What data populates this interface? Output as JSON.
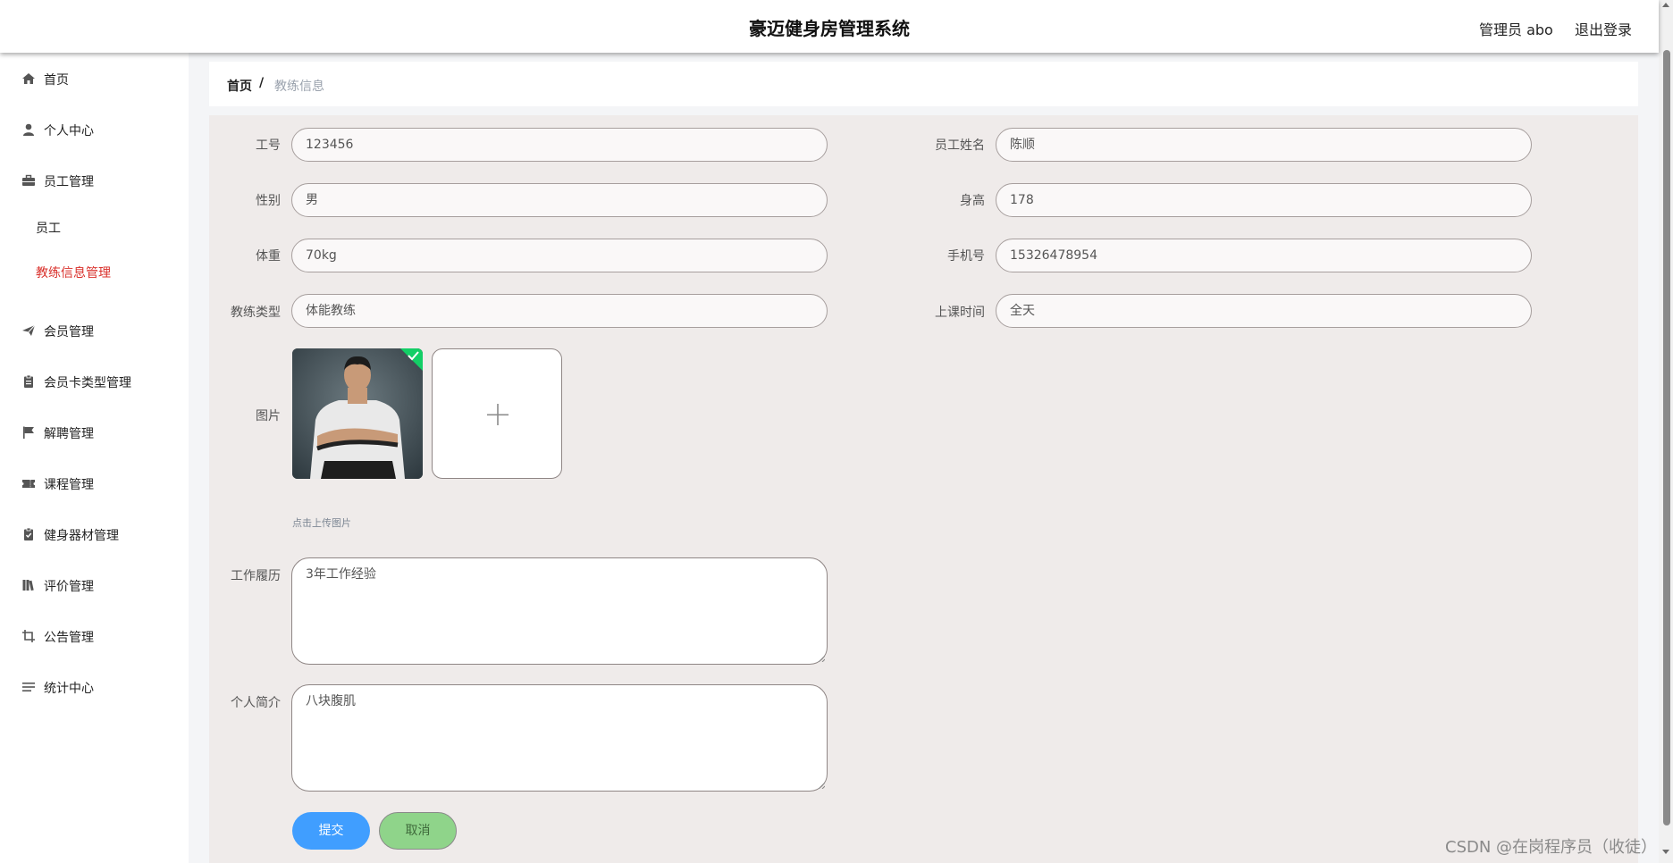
{
  "header": {
    "title": "豪迈健身房管理系统",
    "user_label": "管理员 abo",
    "logout_label": "退出登录"
  },
  "sidebar": {
    "items": [
      {
        "label": "首页",
        "icon": "home-icon"
      },
      {
        "label": "个人中心",
        "icon": "user-icon"
      },
      {
        "label": "员工管理",
        "icon": "briefcase-icon"
      },
      {
        "label": "会员管理",
        "icon": "send-icon"
      },
      {
        "label": "会员卡类型管理",
        "icon": "clipboard-icon"
      },
      {
        "label": "解聘管理",
        "icon": "flag-icon"
      },
      {
        "label": "课程管理",
        "icon": "ticket-icon"
      },
      {
        "label": "健身器材管理",
        "icon": "clipboard-check-icon"
      },
      {
        "label": "评价管理",
        "icon": "books-icon"
      },
      {
        "label": "公告管理",
        "icon": "crop-icon"
      },
      {
        "label": "统计中心",
        "icon": "list-icon"
      }
    ],
    "subitems": [
      {
        "label": "员工",
        "active": false
      },
      {
        "label": "教练信息管理",
        "active": true
      }
    ],
    "active_color": "#d9302b"
  },
  "breadcrumb": {
    "home": "首页",
    "separator": "/",
    "current": "教练信息"
  },
  "form": {
    "job_no": {
      "label": "工号",
      "value": "123456"
    },
    "name": {
      "label": "员工姓名",
      "value": "陈顺"
    },
    "gender": {
      "label": "性别",
      "value": "男"
    },
    "height": {
      "label": "身高",
      "value": "178"
    },
    "weight": {
      "label": "体重",
      "value": "70kg"
    },
    "phone": {
      "label": "手机号",
      "value": "15326478954"
    },
    "coach_type": {
      "label": "教练类型",
      "value": "体能教练"
    },
    "class_time": {
      "label": "上课时间",
      "value": "全天"
    },
    "picture": {
      "label": "图片",
      "hint": "点击上传图片"
    },
    "work_history": {
      "label": "工作履历",
      "value": "3年工作经验"
    },
    "intro": {
      "label": "个人简介",
      "value": "八块腹肌"
    }
  },
  "buttons": {
    "submit": "提交",
    "cancel": "取消"
  },
  "colors": {
    "primary": "#409eff",
    "cancel": "#8fd48a",
    "panel": "#efebea"
  },
  "watermark": "CSDN @在岗程序员（收徒）"
}
